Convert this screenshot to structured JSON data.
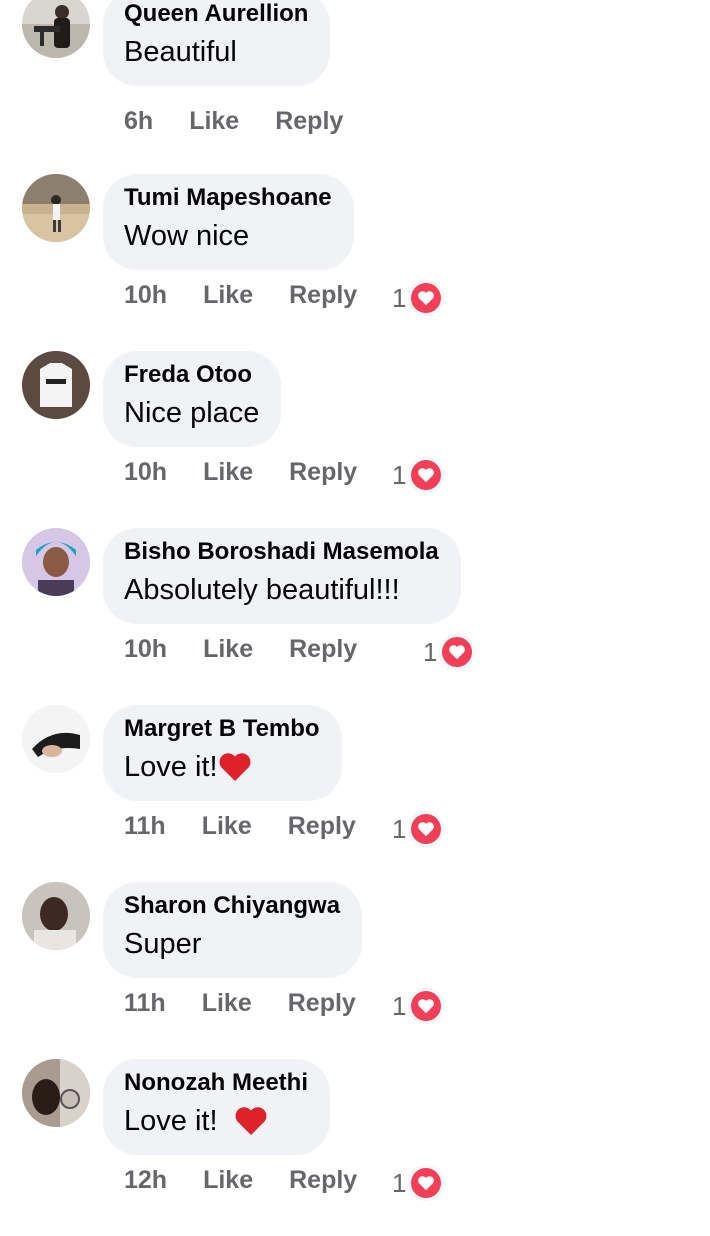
{
  "comments": [
    {
      "author": "Queen Aurellion",
      "text": "Beautiful",
      "time": "6h",
      "like": "Like",
      "reply": "Reply",
      "reaction_count": null,
      "emoji": null
    },
    {
      "author": "Tumi Mapeshoane",
      "text": "Wow nice",
      "time": "10h",
      "like": "Like",
      "reply": "Reply",
      "reaction_count": "1",
      "emoji": null
    },
    {
      "author": "Freda Otoo",
      "text": "Nice place",
      "time": "10h",
      "like": "Like",
      "reply": "Reply",
      "reaction_count": "1",
      "emoji": null
    },
    {
      "author": "Bisho Boroshadi Masemola",
      "text": "Absolutely beautiful!!!",
      "time": "10h",
      "like": "Like",
      "reply": "Reply",
      "reaction_count": "1",
      "emoji": null
    },
    {
      "author": "Margret B Tembo",
      "text": "Love it!",
      "time": "11h",
      "like": "Like",
      "reply": "Reply",
      "reaction_count": "1",
      "emoji": "red-heart"
    },
    {
      "author": "Sharon Chiyangwa",
      "text": "Super",
      "time": "11h",
      "like": "Like",
      "reply": "Reply",
      "reaction_count": "1",
      "emoji": null
    },
    {
      "author": "Nonozah Meethi",
      "text": "Love it! ",
      "time": "12h",
      "like": "Like",
      "reply": "Reply",
      "reaction_count": "1",
      "emoji": "red-heart"
    }
  ],
  "colors": {
    "bubble_bg": "#f0f2f5",
    "meta_text": "#65676b",
    "love_reaction": "#f33e58",
    "name_text": "#050505"
  },
  "icons": {
    "reaction": "love-reaction-icon",
    "emoji": "red-heart-emoji-icon"
  }
}
